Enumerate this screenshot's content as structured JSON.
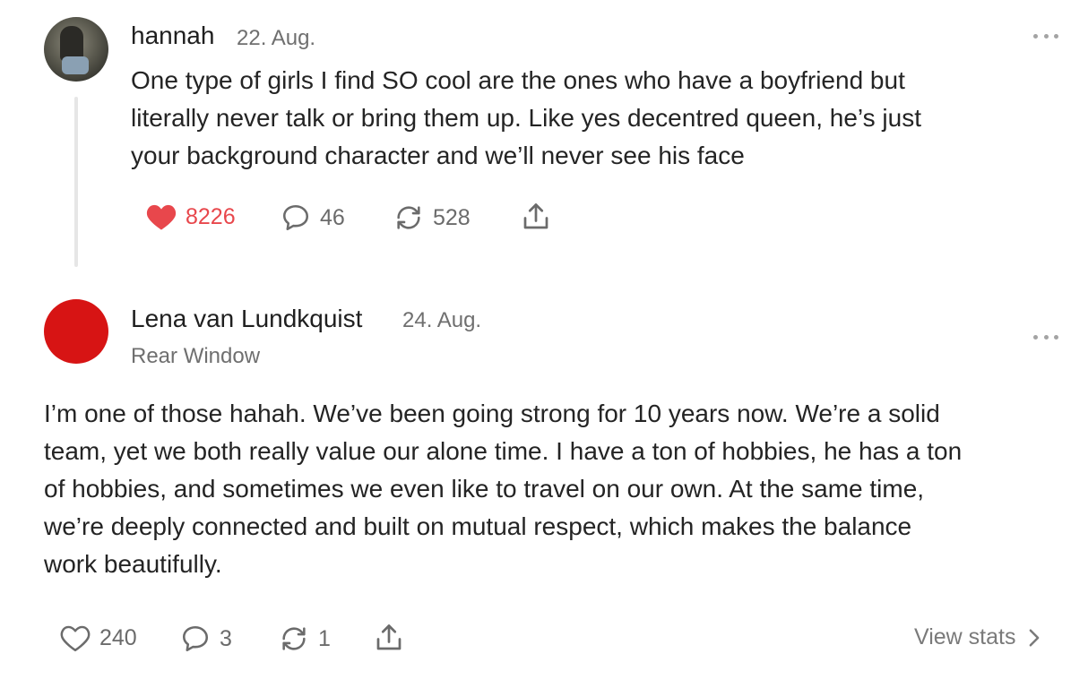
{
  "posts": [
    {
      "author": "hannah",
      "date": "22. Aug.",
      "text_lines": [
        "One type of girls I find SO cool are the ones who have a boyfriend but",
        "literally never talk or bring them up. Like yes decentred queen, he’s just",
        "your background character and we’ll never see his face"
      ],
      "likes": "8226",
      "liked": true,
      "comments": "46",
      "restacks": "528",
      "icons": {
        "like": "heart-filled-icon",
        "comment": "comment-icon",
        "restack": "restack-icon",
        "share": "share-icon",
        "more": "more-options-icon"
      },
      "colors": {
        "like_active": "#e8474c"
      }
    },
    {
      "author": "Lena van Lundkquist",
      "date": "24. Aug.",
      "subtitle": "Rear Window",
      "text_lines": [
        "I’m one of those hahah. We’ve been going strong for 10 years now. We’re a solid",
        "team, yet we both really value our alone time. I have a ton of hobbies, he has a ton",
        "of hobbies, and sometimes we even like to travel on our own. At the same time,",
        "we’re deeply connected and built on mutual respect, which makes the balance",
        "work beautifully."
      ],
      "likes": "240",
      "liked": false,
      "comments": "3",
      "restacks": "1",
      "view_stats_label": "View stats",
      "icons": {
        "like": "heart-outline-icon",
        "comment": "comment-icon",
        "restack": "restack-icon",
        "share": "share-icon",
        "more": "more-options-icon",
        "stats_chevron": "chevron-right-icon"
      },
      "colors": {
        "avatar": "#d71414"
      }
    }
  ]
}
